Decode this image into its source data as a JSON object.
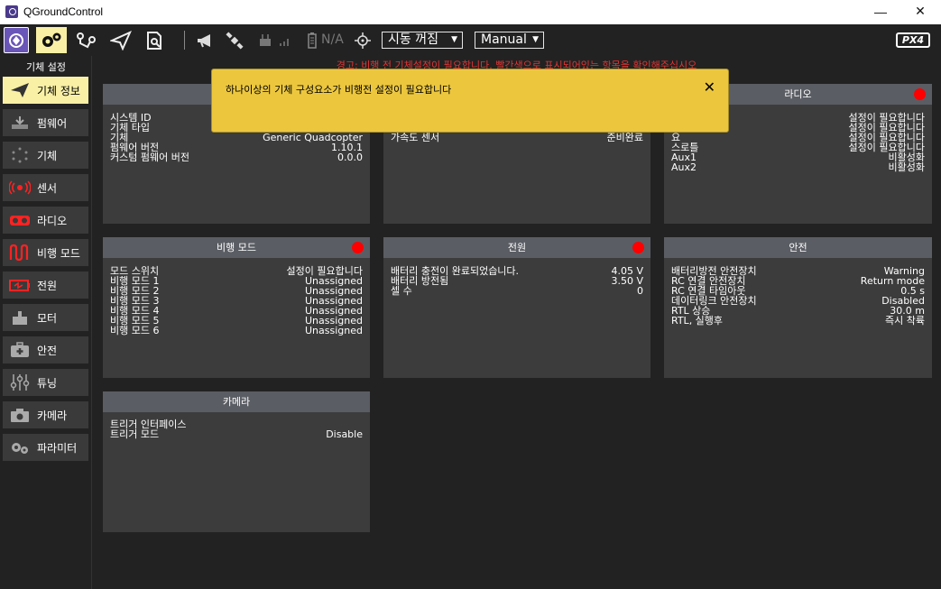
{
  "window": {
    "title": "QGroundControl",
    "minimize": "—",
    "maximize": "☐",
    "close": "✕"
  },
  "toolbar": {
    "telemetry_na": "N/A",
    "arm_state": "시동 꺼짐",
    "flight_mode": "Manual",
    "brand": "PX4"
  },
  "sidebar": {
    "title": "기체 설정",
    "items": [
      {
        "label": "기체 정보",
        "icon": "paper-plane-icon"
      },
      {
        "label": "펌웨어",
        "icon": "download-icon"
      },
      {
        "label": "기체",
        "icon": "vehicle-dots-icon"
      },
      {
        "label": "센서",
        "icon": "sensor-icon"
      },
      {
        "label": "라디오",
        "icon": "radio-icon"
      },
      {
        "label": "비행 모드",
        "icon": "flight-mode-icon"
      },
      {
        "label": "전원",
        "icon": "battery-icon"
      },
      {
        "label": "모터",
        "icon": "motor-icon"
      },
      {
        "label": "안전",
        "icon": "first-aid-icon"
      },
      {
        "label": "튜닝",
        "icon": "sliders-icon"
      },
      {
        "label": "카메라",
        "icon": "camera-icon"
      },
      {
        "label": "파라미터",
        "icon": "gears-icon"
      }
    ]
  },
  "warning_banner": "경고: 비행 전 기체설정이 필요합니다. 빨간색으로 표시되어있는 항목을 확인해주십시오",
  "toast": {
    "message": "하나이상의 기체 구성요소가 비행전 설정이 필요합니다",
    "close": "✕"
  },
  "cards": {
    "vehicle": {
      "title": "",
      "rows": [
        {
          "label": "시스템 ID",
          "value": ""
        },
        {
          "label": "기체 타입",
          "value": ""
        },
        {
          "label": "기체",
          "value": "Generic Quadcopter"
        },
        {
          "label": "펌웨어 버전",
          "value": "1.10.1"
        },
        {
          "label": "커스텀 펌웨어 버전",
          "value": "0.0.0"
        }
      ]
    },
    "sensors": {
      "title": "",
      "rows": [
        {
          "label": "가속도 센서",
          "value": "준비완료"
        }
      ]
    },
    "radio": {
      "title": "라디오",
      "rows": [
        {
          "label": "",
          "value": "설정이 필요합니다"
        },
        {
          "label": "",
          "value": "설정이 필요합니다"
        },
        {
          "label": "요",
          "value": "설정이 필요합니다"
        },
        {
          "label": "스로틀",
          "value": "설정이 필요합니다"
        },
        {
          "label": "Aux1",
          "value": "비활성화"
        },
        {
          "label": "Aux2",
          "value": "비활성화"
        }
      ]
    },
    "flight_modes": {
      "title": "비행 모드",
      "rows": [
        {
          "label": "모드 스위치",
          "value": "설정이 필요합니다"
        },
        {
          "label": "비행 모드 1",
          "value": "Unassigned"
        },
        {
          "label": "비행 모드 2",
          "value": "Unassigned"
        },
        {
          "label": "비행 모드 3",
          "value": "Unassigned"
        },
        {
          "label": "비행 모드 4",
          "value": "Unassigned"
        },
        {
          "label": "비행 모드 5",
          "value": "Unassigned"
        },
        {
          "label": "비행 모드 6",
          "value": "Unassigned"
        }
      ]
    },
    "power": {
      "title": "전원",
      "rows": [
        {
          "label": "배터리 충전이 완료되었습니다.",
          "value": "4.05 V"
        },
        {
          "label": "배터리 방전됨",
          "value": "3.50 V"
        },
        {
          "label": "셀 수",
          "value": "0"
        }
      ]
    },
    "safety": {
      "title": "안전",
      "rows": [
        {
          "label": "배터리방전 안전장치",
          "value": "Warning"
        },
        {
          "label": "RC 연결 안전장치",
          "value": "Return mode"
        },
        {
          "label": "RC 연결 타임아웃",
          "value": "0.5 s"
        },
        {
          "label": "데이터링크 안전장치",
          "value": "Disabled"
        },
        {
          "label": "RTL 상승",
          "value": "30.0 m"
        },
        {
          "label": "RTL, 실행후",
          "value": "즉시 착륙"
        }
      ]
    },
    "camera": {
      "title": "카메라",
      "rows": [
        {
          "label": "트리거 인터페이스",
          "value": ""
        },
        {
          "label": "트리거 모드",
          "value": "Disable"
        }
      ]
    }
  },
  "colors": {
    "accent_yellow": "#ecc73e",
    "active_item": "#f9f0a6",
    "warning_red": "#e03535",
    "status_red": "#ff0000"
  }
}
